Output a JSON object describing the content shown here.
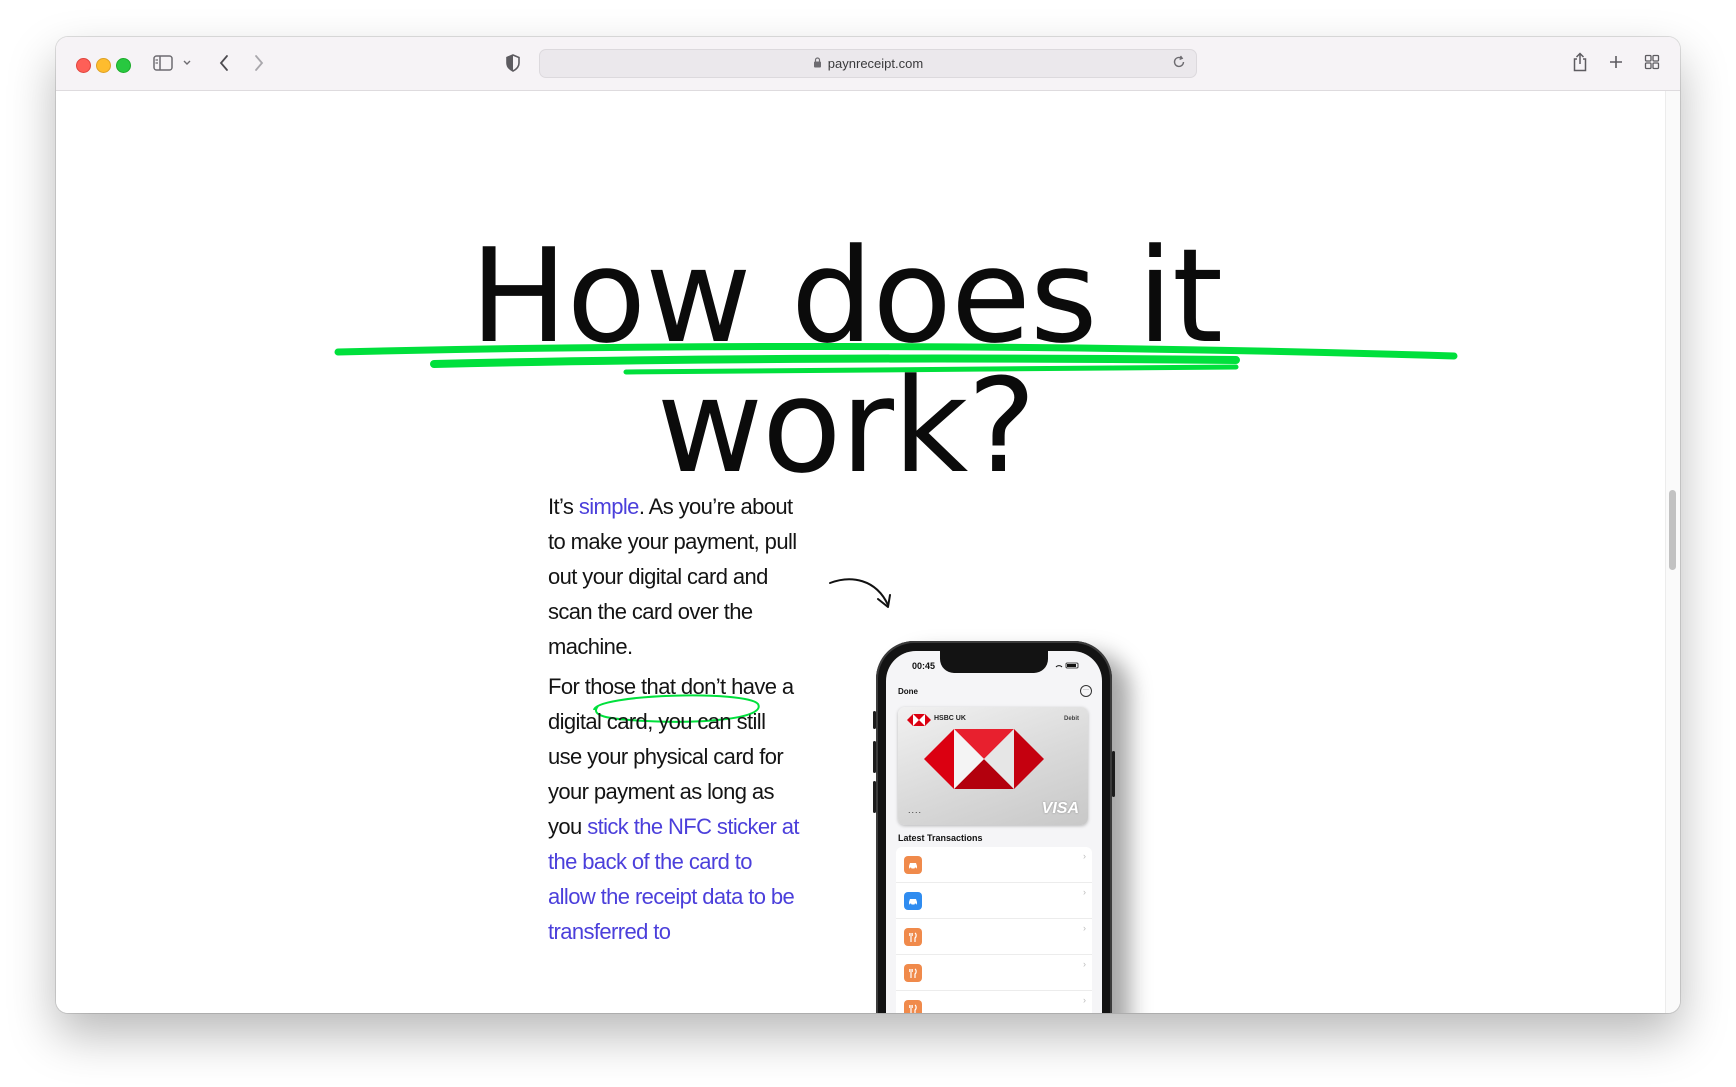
{
  "browser": {
    "url": "paynreceipt.com"
  },
  "page": {
    "headline": "How does it work?",
    "para1": {
      "part1": "It’s ",
      "link": "simple",
      "part2": ". As you’re about to make your payment, pull out your digital card and scan the card over the machine."
    },
    "para2": {
      "part1": "For those that don’t have a digital card, you can still use your physical card for your payment as long as you ",
      "link": "stick the NFC sticker at the back of the card to allow the receipt data to be transferred to"
    }
  },
  "phone": {
    "time": "00:45",
    "done_label": "Done",
    "card_bank": "HSBC UK",
    "card_type": "Debit",
    "card_dots": "....",
    "card_network": "VISA",
    "transactions_title": "Latest Transactions",
    "transactions": [
      {
        "icon": "car-icon",
        "color": "#f08a4b"
      },
      {
        "icon": "car-icon",
        "color": "#2f8cf0"
      },
      {
        "icon": "fork-knife-icon",
        "color": "#f08a4b"
      },
      {
        "icon": "fork-knife-icon",
        "color": "#f08a4b"
      },
      {
        "icon": "fork-knife-icon",
        "color": "#f08a4b"
      }
    ]
  },
  "colors": {
    "accent_link": "#4b3fdb",
    "highlight_green": "#00e03c"
  }
}
